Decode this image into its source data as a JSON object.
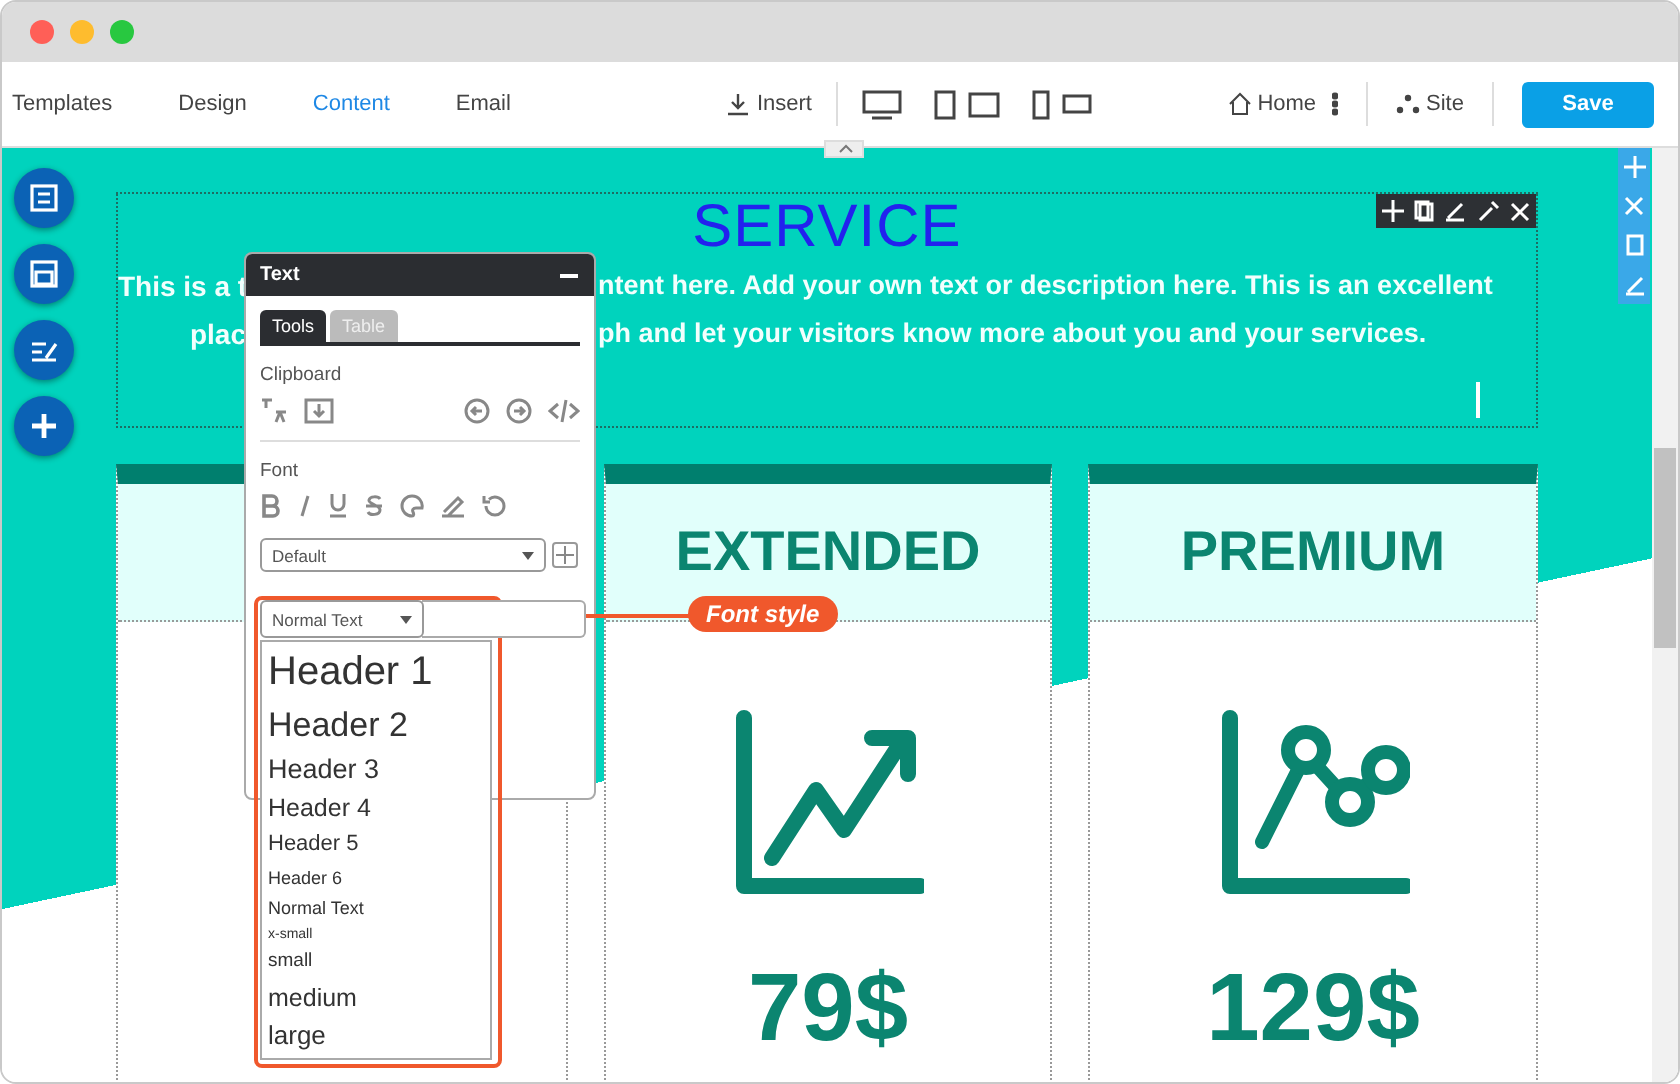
{
  "nav_tabs": [
    {
      "label": "Templates",
      "selected": false
    },
    {
      "label": "Design",
      "selected": false
    },
    {
      "label": "Content",
      "selected": true
    },
    {
      "label": "Email",
      "selected": false
    }
  ],
  "insert_label": "Insert",
  "home_label": "Home",
  "site_label": "Site",
  "save_button": "Save",
  "section": {
    "title": "SERVICE",
    "paragraph_lines": [
      {
        "left": "This is a t",
        "right": "ntent here. Add your own text or description here. This is an excellent"
      },
      {
        "left": "plac",
        "right": "ph and let your visitors know more about you and your services."
      }
    ]
  },
  "cards": [
    {
      "kind": "blank"
    },
    {
      "kind": "growth",
      "title": "EXTENDED",
      "price": "79$"
    },
    {
      "kind": "scatter",
      "title": "PREMIUM",
      "price": "129$"
    }
  ],
  "text_panel": {
    "title": "Text",
    "tabs": [
      {
        "label": "Tools",
        "selected": true
      },
      {
        "label": "Table",
        "selected": false
      }
    ],
    "clipboard_label": "Clipboard",
    "font_label": "Font",
    "font_family_value": "Default",
    "style_value": "Normal Text",
    "style_options": [
      "Header 1",
      "Header 2",
      "Header 3",
      "Header 4",
      "Header 5",
      "Header 6",
      "Normal Text",
      "x-small",
      "small",
      "medium",
      "large"
    ]
  },
  "callout": {
    "label": "Font style"
  }
}
